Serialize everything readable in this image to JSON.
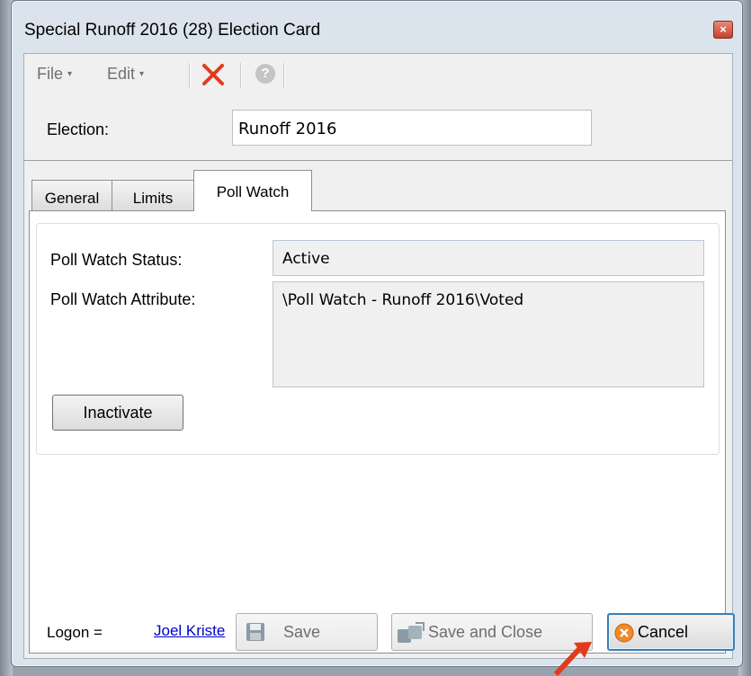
{
  "window": {
    "title": "Special Runoff 2016 (28) Election Card",
    "close_glyph": "×"
  },
  "toolbar": {
    "file_label": "File",
    "edit_label": "Edit",
    "menu_arrow": "▾",
    "delete_icon": "red-x-icon",
    "help_icon": "help-icon",
    "help_glyph": "?"
  },
  "election": {
    "label": "Election:",
    "value": "Runoff 2016"
  },
  "tabs": [
    {
      "label": "General",
      "active": false
    },
    {
      "label": "Limits",
      "active": false
    },
    {
      "label": "Poll Watch",
      "active": true
    }
  ],
  "poll_watch": {
    "status_label": "Poll Watch Status:",
    "status_value": "Active",
    "attribute_label": "Poll Watch Attribute:",
    "attribute_value": "\\Poll Watch - Runoff 2016\\Voted",
    "inactivate_button": "Inactivate"
  },
  "footer": {
    "logon_label": "Logon =",
    "logon_user": "Joel Kriste",
    "save_button": "Save",
    "save_close_button": "Save and Close",
    "cancel_button": "Cancel"
  },
  "colors": {
    "accent_red": "#e23b1c",
    "link_blue": "#0000cc",
    "cancel_icon": "#f08a2a"
  }
}
